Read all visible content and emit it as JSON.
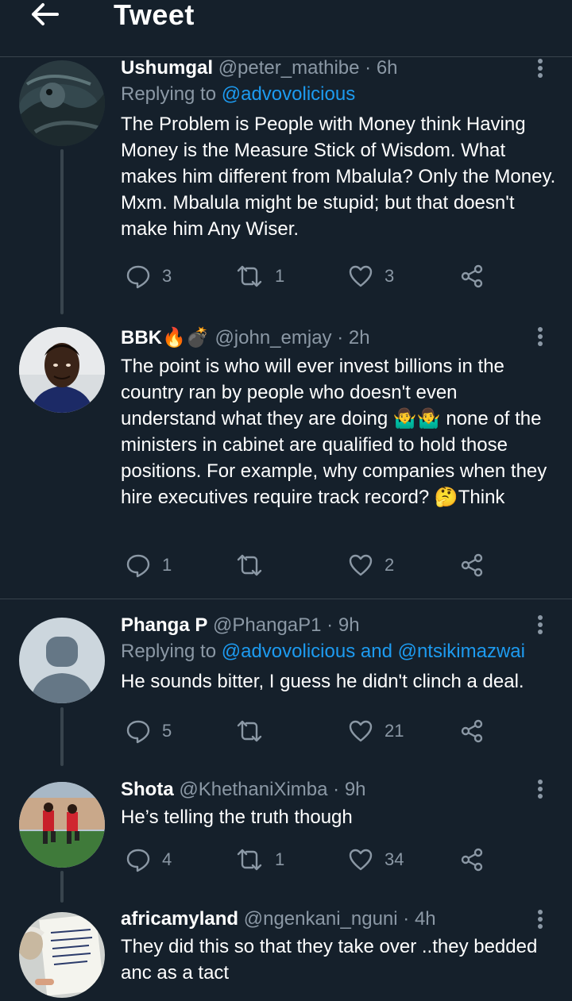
{
  "header": {
    "title": "Tweet",
    "back_icon": "arrow-left-icon"
  },
  "tweets": [
    {
      "name": "Ushumgal",
      "name_emoji": "",
      "handle": "@peter_mathibe",
      "sep": "·",
      "time": "6h",
      "reply_prefix": "Replying to ",
      "reply_mentions": "@advovolicious",
      "reply_and": "",
      "reply_mentions_2": "",
      "text": "The Problem is People with Money think Having Money is the Measure Stick of Wisdom. What makes him different from Mbalula? Only the Money. Mxm. Mbalula might be stupid; but that doesn't make him Any Wiser.",
      "replies": "3",
      "retweets": "1",
      "likes": "3"
    },
    {
      "name": "BBK",
      "name_emoji": "🔥💣",
      "handle": "@john_emjay",
      "sep": "·",
      "time": "2h",
      "text_part1": "The point is who will ever invest billions in the country ran by people who doesn't even understand what they are doing ",
      "text_emoji1": "🤷‍♂️🤷‍♂️",
      "text_part2": " none of the ministers in cabinet are qualified to hold those positions. For example, why companies when they hire executives require track record? ",
      "text_emoji2": "🤔",
      "text_part3": "Think",
      "replies": "1",
      "retweets": "",
      "likes": "2"
    },
    {
      "name": "Phanga P",
      "handle": "@PhangaP1",
      "sep": "·",
      "time": "9h",
      "reply_prefix": "Replying to ",
      "reply_mentions": "@advovolicious",
      "reply_and": " and ",
      "reply_mentions_2": "@ntsikimazwai",
      "text": "He sounds bitter, I guess he didn't clinch a deal.",
      "replies": "5",
      "retweets": "",
      "likes": "21"
    },
    {
      "name": "Shota",
      "handle": "@KhethaniXimba",
      "sep": "·",
      "time": "9h",
      "text": "He’s telling the truth though",
      "replies": "4",
      "retweets": "1",
      "likes": "34"
    },
    {
      "name": "africamyland",
      "handle": "@ngenkani_nguni",
      "sep": "·",
      "time": "4h",
      "text": "They did this so that they take over ..they bedded anc as a tact",
      "replies": "",
      "retweets": "",
      "likes": ""
    }
  ],
  "colors": {
    "background": "#15202b",
    "divider": "#38444d",
    "secondary_text": "#8b98a5",
    "accent": "#1d9bf0"
  },
  "icons": {
    "reply": "reply-icon",
    "retweet": "retweet-icon",
    "like": "heart-icon",
    "share": "share-icon",
    "more": "more-vertical-icon"
  }
}
